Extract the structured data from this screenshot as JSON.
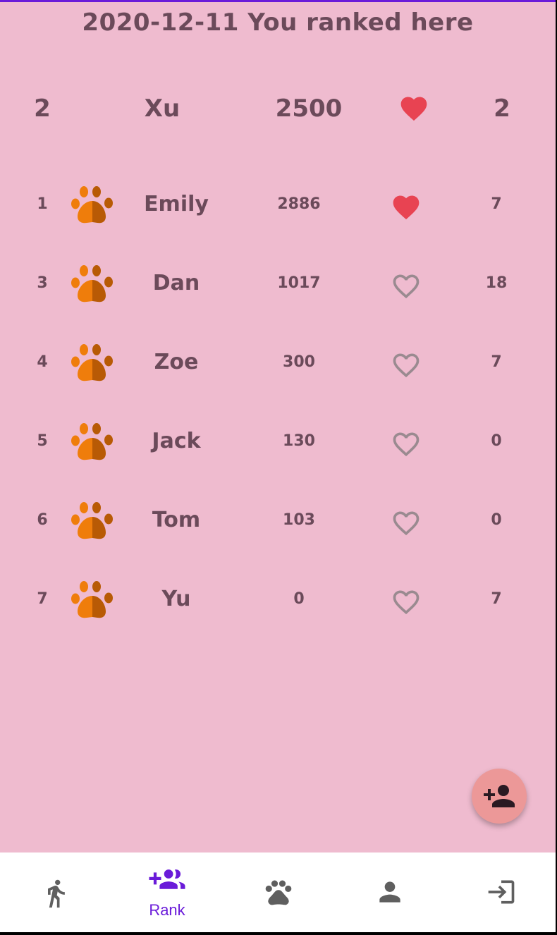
{
  "title": "2020-12-11  You ranked here",
  "me": {
    "rank": "2",
    "name": "Xu",
    "score": "2500",
    "liked": true,
    "likes": "2"
  },
  "leaderboard": [
    {
      "rank": "1",
      "name": "Emily",
      "score": "2886",
      "liked": true,
      "likes": "7"
    },
    {
      "rank": "3",
      "name": "Dan",
      "score": "1017",
      "liked": false,
      "likes": "18"
    },
    {
      "rank": "4",
      "name": "Zoe",
      "score": "300",
      "liked": false,
      "likes": "7"
    },
    {
      "rank": "5",
      "name": "Jack",
      "score": "130",
      "liked": false,
      "likes": "0"
    },
    {
      "rank": "6",
      "name": "Tom",
      "score": "103",
      "liked": false,
      "likes": "0"
    },
    {
      "rank": "7",
      "name": "Yu",
      "score": "0",
      "liked": false,
      "likes": "7"
    }
  ],
  "nav": {
    "items": [
      {
        "icon": "walk-icon",
        "label": "",
        "active": false
      },
      {
        "icon": "group-add-icon",
        "label": "Rank",
        "active": true
      },
      {
        "icon": "paw-icon",
        "label": "",
        "active": false
      },
      {
        "icon": "person-icon",
        "label": "",
        "active": false
      },
      {
        "icon": "login-icon",
        "label": "",
        "active": false
      }
    ]
  },
  "fab": {
    "icon": "person-add-icon"
  },
  "colors": {
    "background": "#efbbcf",
    "text": "#6b4a5a",
    "heart_filled": "#e84352",
    "heart_outline": "#9a8a90",
    "paw_light": "#ef7d0b",
    "paw_dark": "#b85a05",
    "accent": "#6a1bd9",
    "fab": "#ec9898"
  }
}
